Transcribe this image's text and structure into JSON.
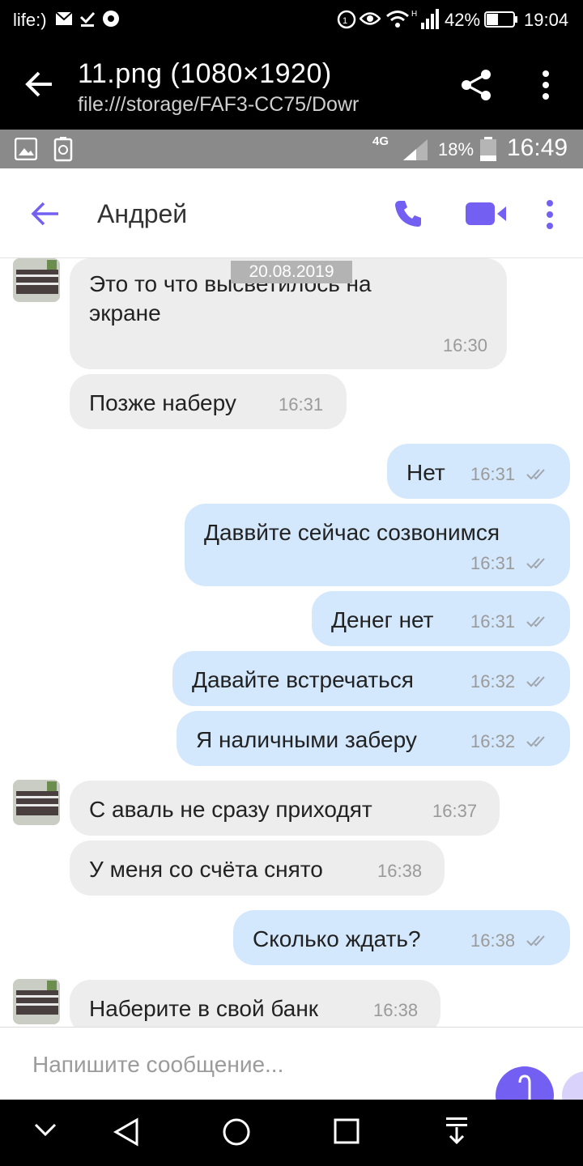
{
  "outer_status": {
    "carrier": "life:)",
    "battery": "42%",
    "time": "19:04"
  },
  "viewer": {
    "title": "11.png (1080×1920)",
    "path": "file:///storage/FAF3-CC75/Dowr"
  },
  "inner_status": {
    "network": "4G",
    "battery": "18%",
    "time": "16:49"
  },
  "header": {
    "contact_name": "Андрей"
  },
  "date_badge": "20.08.2019",
  "messages": [
    {
      "dir": "in",
      "text1": "Это то что высветилось на",
      "text2": "экране",
      "time": "16:30"
    },
    {
      "dir": "in",
      "text": "Позже наберу",
      "time": "16:31"
    },
    {
      "dir": "out",
      "text": "Нет",
      "time": "16:31"
    },
    {
      "dir": "out",
      "text": "Даввйте сейчас созвонимся",
      "time": "16:31"
    },
    {
      "dir": "out",
      "text": "Денег нет",
      "time": "16:31"
    },
    {
      "dir": "out",
      "text": "Давайте встречаться",
      "time": "16:32"
    },
    {
      "dir": "out",
      "text": "Я наличными заберу",
      "time": "16:32"
    },
    {
      "dir": "in",
      "text": "С аваль не сразу приходят",
      "time": "16:37"
    },
    {
      "dir": "in",
      "text": "У меня со счёта снято",
      "time": "16:38"
    },
    {
      "dir": "out",
      "text": "Сколько ждать?",
      "time": "16:38"
    },
    {
      "dir": "in",
      "text": "Наберите в свой банк",
      "time": "16:38"
    }
  ],
  "composer": {
    "placeholder": "Напишите сообщение..."
  },
  "colors": {
    "accent": "#7360f2",
    "incoming_bubble": "#ededed",
    "outgoing_bubble": "#d4e8fd"
  }
}
